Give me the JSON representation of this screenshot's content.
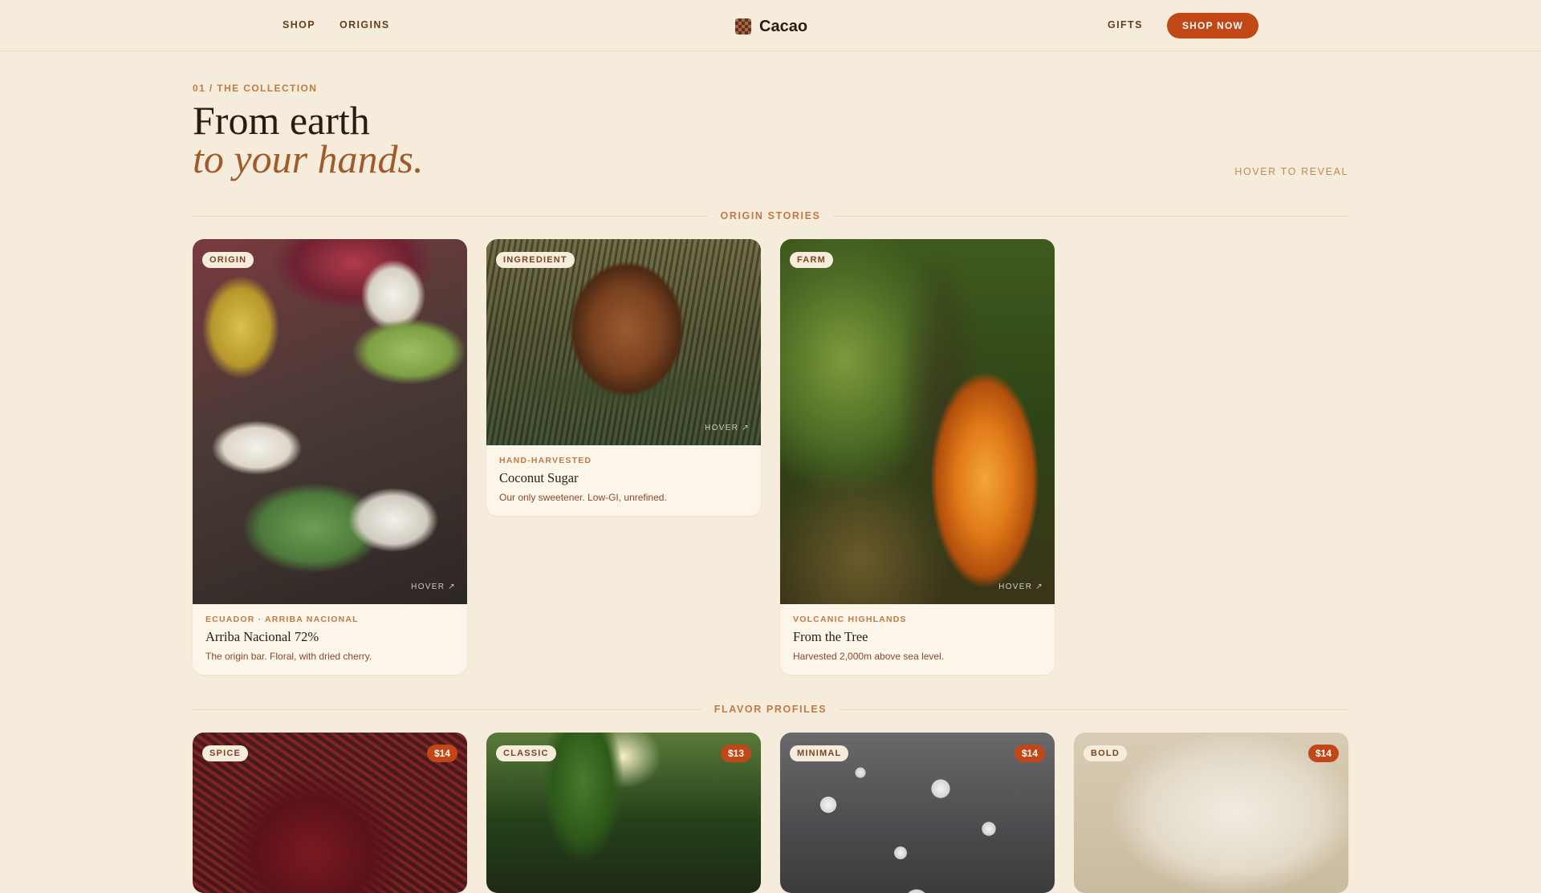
{
  "nav": {
    "left_links": [
      "SHOP",
      "ORIGINS"
    ],
    "brand": "Cacao",
    "right_link": "GIFTS",
    "cta": "SHOP NOW"
  },
  "hero": {
    "eyebrow": "01 / THE COLLECTION",
    "title_line1": "From earth",
    "title_line2": "to your hands.",
    "hint": "HOVER TO REVEAL"
  },
  "sections": {
    "origin_stories": "ORIGIN STORIES",
    "flavor_profiles": "FLAVOR PROFILES"
  },
  "origin_cards": [
    {
      "tag": "ORIGIN",
      "hover": "HOVER ↗",
      "kicker": "ECUADOR · ARRIBA NACIONAL",
      "title": "Arriba Nacional 72%",
      "desc": "The origin bar. Floral, with dried cherry."
    },
    {
      "tag": "INGREDIENT",
      "hover": "HOVER ↗",
      "kicker": "HAND-HARVESTED",
      "title": "Coconut Sugar",
      "desc": "Our only sweetener. Low-GI, unrefined."
    },
    {
      "tag": "FARM",
      "hover": "HOVER ↗",
      "kicker": "VOLCANIC HIGHLANDS",
      "title": "From the Tree",
      "desc": "Harvested 2,000m above sea level."
    }
  ],
  "flavor_cards": [
    {
      "tag": "SPICE",
      "price": "$14"
    },
    {
      "tag": "CLASSIC",
      "price": "$13"
    },
    {
      "tag": "MINIMAL",
      "price": "$14"
    },
    {
      "tag": "BOLD",
      "price": "$14"
    }
  ],
  "colors": {
    "background": "#f6ecdb",
    "accent": "#c24717",
    "eyebrow": "#c07a44",
    "heading": "#2b1a10",
    "heading_italic": "#a05a2c"
  }
}
